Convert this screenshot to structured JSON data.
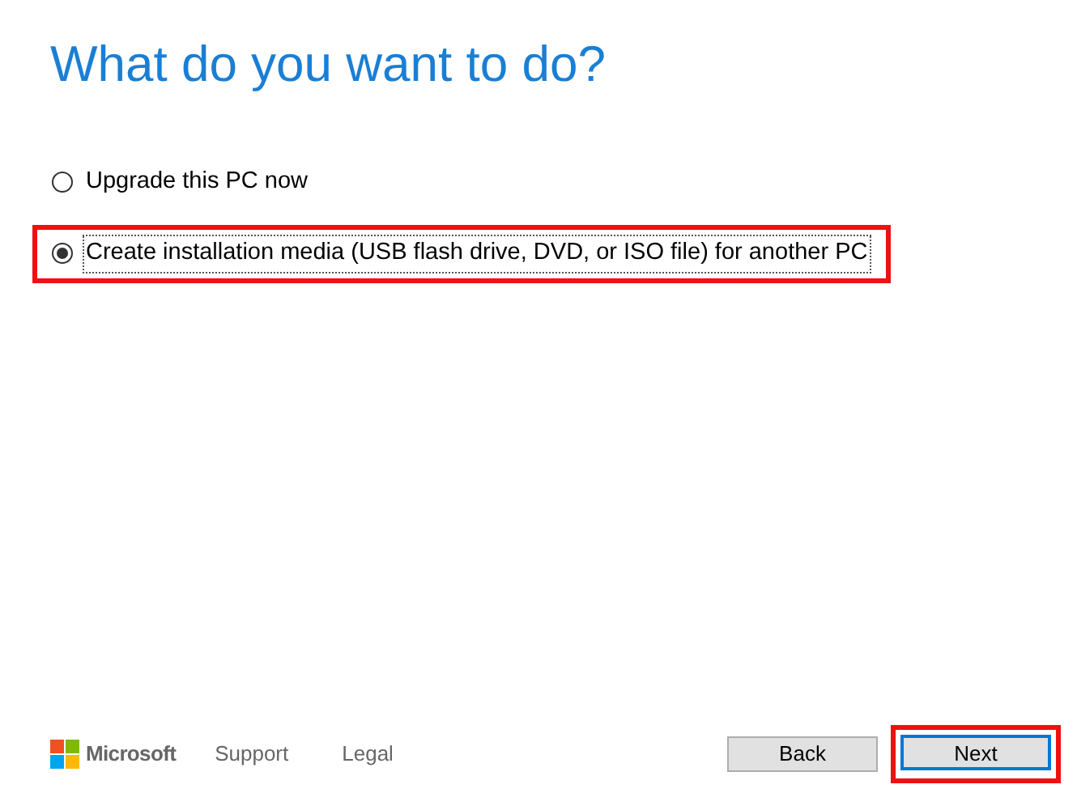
{
  "heading": "What do you want to do?",
  "options": [
    {
      "label": "Upgrade this PC now",
      "selected": false,
      "highlighted": false
    },
    {
      "label": "Create installation media (USB flash drive, DVD, or ISO file) for another PC",
      "selected": true,
      "highlighted": true
    }
  ],
  "footer": {
    "brand": "Microsoft",
    "links": [
      "Support",
      "Legal"
    ]
  },
  "buttons": [
    {
      "label": "Back",
      "default": false,
      "highlighted": false
    },
    {
      "label": "Next",
      "default": true,
      "highlighted": true
    }
  ]
}
